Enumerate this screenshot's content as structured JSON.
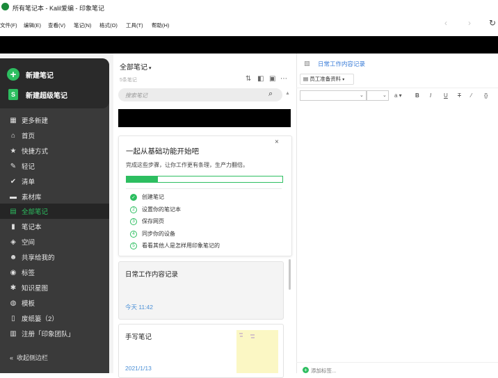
{
  "window": {
    "title": "所有笔记本 - Kalil爱编 - 印象笔记"
  },
  "menu": [
    "文件(F)",
    "编辑(E)",
    "查看(V)",
    "笔记(N)",
    "格式(O)",
    "工具(T)",
    "帮助(H)"
  ],
  "sidebar": {
    "new_note": "新建笔记",
    "new_super_note": "新建超级笔记",
    "items": [
      {
        "label": "更多新建",
        "icon": "grid-icon"
      },
      {
        "label": "首页",
        "icon": "home-icon"
      },
      {
        "label": "快捷方式",
        "icon": "star-icon"
      },
      {
        "label": "轻记",
        "icon": "pen-icon"
      },
      {
        "label": "清单",
        "icon": "check-icon"
      },
      {
        "label": "素材库",
        "icon": "briefcase-icon"
      },
      {
        "label": "全部笔记",
        "icon": "notes-icon"
      },
      {
        "label": "笔记本",
        "icon": "notebook-icon"
      },
      {
        "label": "空间",
        "icon": "cube-icon"
      },
      {
        "label": "共享给我的",
        "icon": "people-icon"
      },
      {
        "label": "标签",
        "icon": "tag-icon"
      },
      {
        "label": "知识星图",
        "icon": "graph-icon"
      },
      {
        "label": "模板",
        "icon": "template-icon"
      },
      {
        "label": "废纸篓（2）",
        "icon": "trash-icon"
      },
      {
        "label": "注册「印象团队」",
        "icon": "team-icon"
      }
    ],
    "collapse": "收起侧边栏"
  },
  "list": {
    "title": "全部笔记",
    "count": "5条笔记",
    "search_placeholder": "搜索笔记"
  },
  "onboarding": {
    "title": "一起从基础功能开始吧",
    "subtitle": "完成这些步骤，让你工作更有条理，生产力翻倍。",
    "progress": 0.2,
    "steps": [
      {
        "num": "✓",
        "label": "创建笔记",
        "done": true
      },
      {
        "num": "2",
        "label": "设置你的笔记本",
        "done": false
      },
      {
        "num": "3",
        "label": "保存网页",
        "done": false
      },
      {
        "num": "4",
        "label": "同步你的设备",
        "done": false
      },
      {
        "num": "5",
        "label": "看看其他人是怎样用印象笔记的",
        "done": false
      }
    ]
  },
  "notes": [
    {
      "title": "日常工作内容记录",
      "date": "今天 11:42"
    },
    {
      "title": "手写笔记",
      "date": "2021/1/13"
    }
  ],
  "editor": {
    "title": "日常工作内容记录",
    "notebook": "员工准备资料",
    "toolbar": [
      "a",
      "B",
      "I",
      "U",
      "T",
      "⁄",
      "{}"
    ],
    "add_tag": "添加标签..."
  }
}
